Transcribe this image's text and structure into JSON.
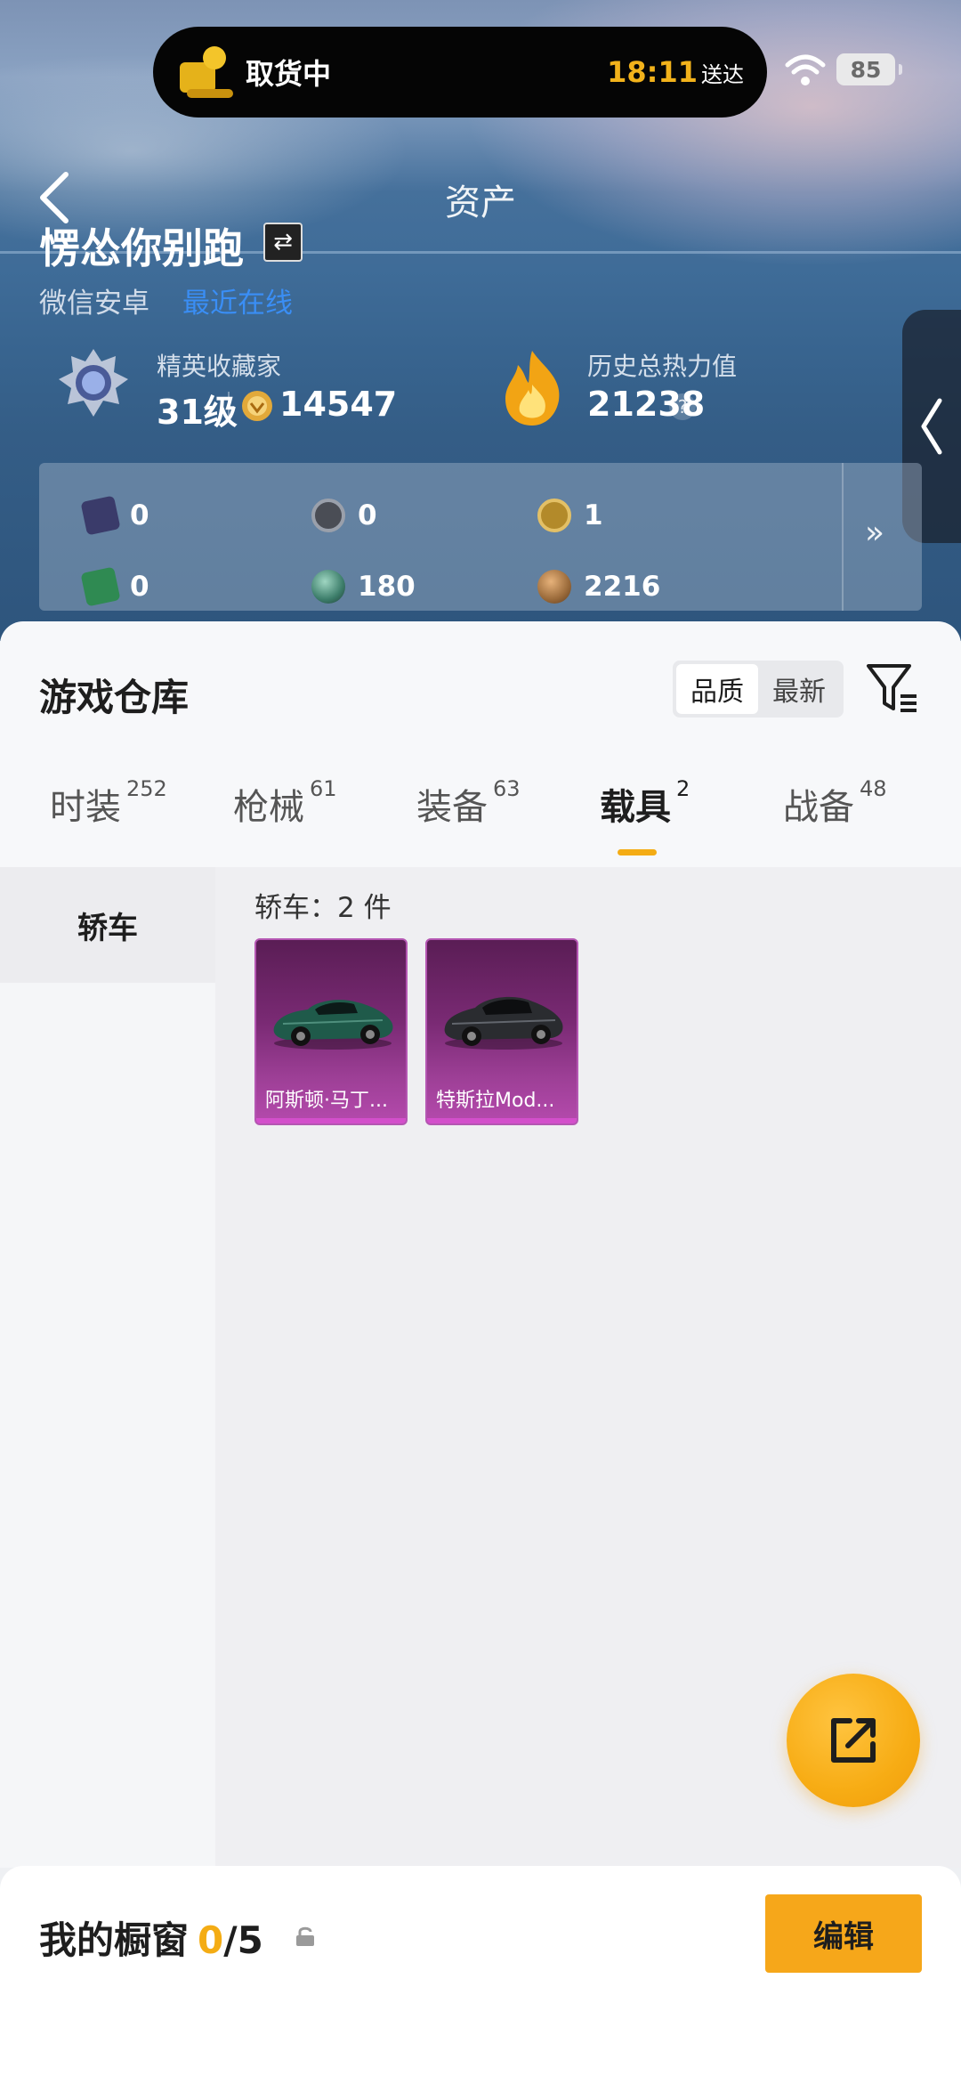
{
  "status_bar": {
    "delivery_text": "取货中",
    "eta_time": "18:11",
    "eta_suffix": "送达",
    "battery": "85"
  },
  "header": {
    "title": "资产",
    "username": "愣怂你别跑",
    "platform": "微信安卓",
    "platform_link": "最近在线"
  },
  "profile": {
    "rank_label": "精英收藏家",
    "rank_level": "31级",
    "rank_points": "14547",
    "heat_label": "历史总热力值",
    "heat_value": "21238",
    "help": "?"
  },
  "resources": [
    {
      "icon": "card-icon",
      "value": "0",
      "color": "#3a3b6a"
    },
    {
      "icon": "silver-coin-icon",
      "value": "0",
      "color": "#4a4d55"
    },
    {
      "icon": "gold-badge-icon",
      "value": "1",
      "color": "#b38a2a"
    },
    {
      "icon": "green-ticket-icon",
      "value": "0",
      "color": "#2f8a52"
    },
    {
      "icon": "orb-icon",
      "value": "180",
      "color": "#3c7d6a"
    },
    {
      "icon": "bronze-coin-icon",
      "value": "2216",
      "color": "#9a6a3a"
    }
  ],
  "resources_more": "»",
  "warehouse": {
    "title": "游戏仓库",
    "sort_quality": "品质",
    "sort_latest": "最新"
  },
  "tabs": [
    {
      "label": "时装",
      "count": "252"
    },
    {
      "label": "枪械",
      "count": "61"
    },
    {
      "label": "装备",
      "count": "63"
    },
    {
      "label": "载具",
      "count": "2"
    },
    {
      "label": "战备",
      "count": "48"
    }
  ],
  "categories": [
    {
      "label": "轿车"
    }
  ],
  "category_count": "轿车：2 件",
  "items": [
    {
      "name": "阿斯顿·马丁...",
      "car_color": "#1f5a4a"
    },
    {
      "name": "特斯拉Mod...",
      "car_color": "#2a2c30"
    }
  ],
  "showcase": {
    "title": "我的橱窗",
    "current": "0",
    "total": "/5",
    "edit_label": "编辑"
  },
  "colors": {
    "accent": "#f4ac14",
    "link": "#3a8ef5",
    "card_purple": "#7a2a74"
  }
}
